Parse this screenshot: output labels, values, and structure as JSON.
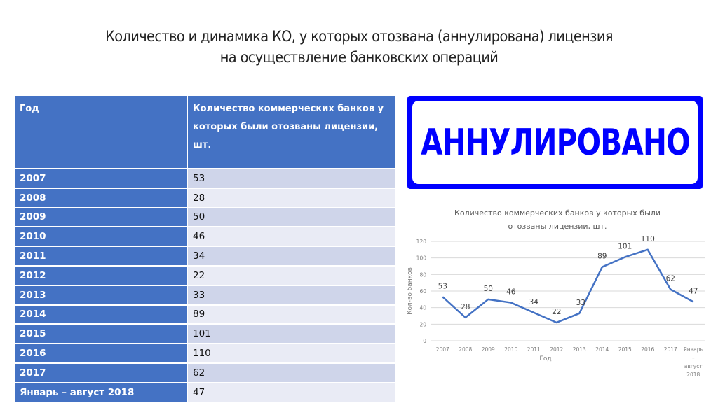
{
  "slide": {
    "title_line1": "Количество и динамика КО, у которых отозвана (аннулирована) лицензия",
    "title_line2": "на осуществление банковских операций"
  },
  "table": {
    "headers": [
      "Год",
      "Количество коммерческих банков у которых были отозваны лицензии, шт."
    ],
    "rows": [
      {
        "year": "2007",
        "value": "53"
      },
      {
        "year": "2008",
        "value": "28"
      },
      {
        "year": "2009",
        "value": "50"
      },
      {
        "year": "2010",
        "value": "46"
      },
      {
        "year": "2011",
        "value": "34"
      },
      {
        "year": "2012",
        "value": "22"
      },
      {
        "year": "2013",
        "value": "33"
      },
      {
        "year": "2014",
        "value": "89"
      },
      {
        "year": "2015",
        "value": "101"
      },
      {
        "year": "2016",
        "value": "110"
      },
      {
        "year": "2017",
        "value": "62"
      },
      {
        "year": "Январь – август 2018",
        "value": "47"
      }
    ]
  },
  "sign": {
    "text": "АННУЛИРОВАНО",
    "color": "#0000ff"
  },
  "chart_data": {
    "type": "line",
    "title": "Количество коммерческих банков у которых были отозваны лицензии, шт.",
    "title_lines": [
      "Количество коммерческих банков у которых были",
      "отозваны лицензии, шт."
    ],
    "xlabel": "Год",
    "ylabel": "Кол-во банков",
    "categories": [
      "2007",
      "2008",
      "2009",
      "2010",
      "2011",
      "2012",
      "2013",
      "2014",
      "2015",
      "2016",
      "2017",
      "Январь – август 2018"
    ],
    "category_label_lines": [
      [
        "2007"
      ],
      [
        "2008"
      ],
      [
        "2009"
      ],
      [
        "2010"
      ],
      [
        "2011"
      ],
      [
        "2012"
      ],
      [
        "2013"
      ],
      [
        "2014"
      ],
      [
        "2015"
      ],
      [
        "2016"
      ],
      [
        "2017"
      ],
      [
        "Январь",
        "–",
        "август",
        "2018"
      ]
    ],
    "series": [
      {
        "name": "Количество коммерческих банков у которых были отозваны лицензии, шт.",
        "values": [
          53,
          28,
          50,
          46,
          34,
          22,
          33,
          89,
          101,
          110,
          62,
          47
        ],
        "color": "#4472c4"
      }
    ],
    "ylim": [
      0,
      120
    ],
    "yticks": [
      0,
      20,
      40,
      60,
      80,
      100,
      120
    ],
    "grid": true,
    "legend": "none",
    "data_labels": true
  }
}
